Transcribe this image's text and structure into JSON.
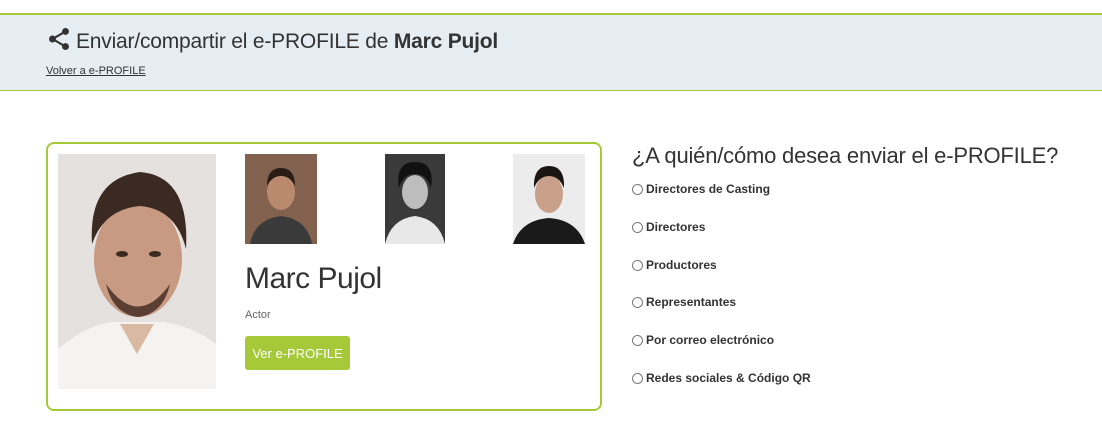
{
  "header": {
    "title_prefix": "Enviar/compartir el e-PROFILE de ",
    "title_name": "Marc Pujol",
    "back_link": "Volver a e-PROFILE",
    "share_icon": "share-icon"
  },
  "colors": {
    "accent": "#a6c93a",
    "header_bg": "#e6eef3"
  },
  "profile": {
    "name": "Marc Pujol",
    "role": "Actor",
    "view_button": "Ver e-PROFILE"
  },
  "send": {
    "question": "¿A quién/cómo desea enviar el e-PROFILE?",
    "options": [
      "Directores de Casting",
      "Directores",
      "Productores",
      "Representantes",
      "Por correo electrónico",
      "Redes sociales & Código QR"
    ]
  }
}
